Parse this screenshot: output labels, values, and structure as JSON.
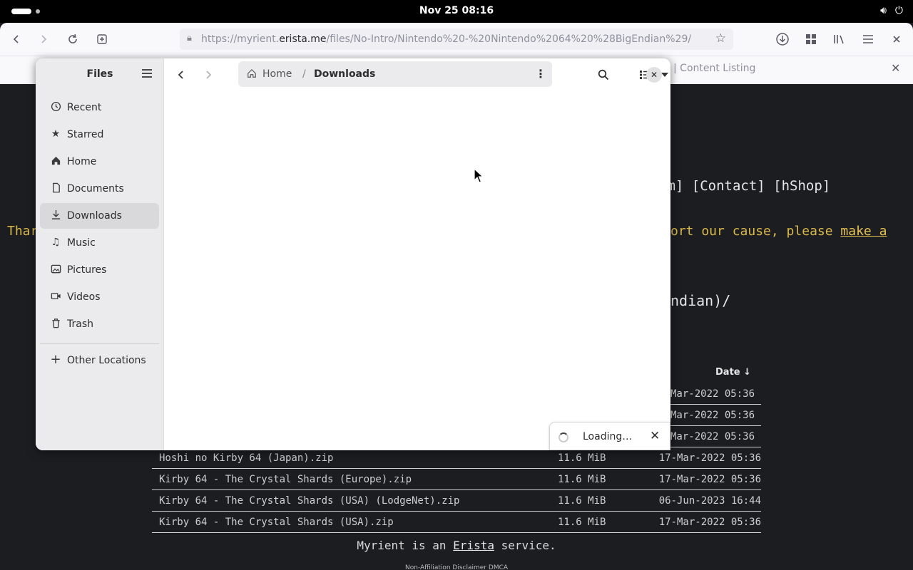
{
  "system": {
    "clock": "Nov 25  08:16",
    "tray": [
      "volume-icon",
      "power-icon"
    ]
  },
  "browser": {
    "url_prefix": "https://myrient.",
    "url_domain": "erista.me",
    "url_path": "/files/No-Intro/Nintendo%20-%20Nintendo%2064%20%28BigEndian%29/",
    "tab_title": "| Content Listing"
  },
  "webpage": {
    "nav_links": "am] [Contact] [hShop]",
    "notice_left": "Thar",
    "notice_right": "ort our cause, please ",
    "notice_link": "make a",
    "path_tail": "ndian)/",
    "date_header": "Date  ↓",
    "hidden_rows_dates": [
      "Mar-2022 05:36",
      "Mar-2022 05:36",
      "Mar-2022 05:36"
    ],
    "files": [
      {
        "name": "Hoshi no Kirby 64 (Japan).zip",
        "size": "11.6 MiB",
        "date": "17-Mar-2022 05:36"
      },
      {
        "name": "Kirby 64 - The Crystal Shards (Europe).zip",
        "size": "11.6 MiB",
        "date": "17-Mar-2022 05:36"
      },
      {
        "name": "Kirby 64 - The Crystal Shards (USA) (LodgeNet).zip",
        "size": "11.6 MiB",
        "date": "06-Jun-2023 16:44"
      },
      {
        "name": "Kirby 64 - The Crystal Shards (USA).zip",
        "size": "11.6 MiB",
        "date": "17-Mar-2022 05:36"
      }
    ],
    "footer_pre": "Myrient is an ",
    "footer_link": "Erista",
    "footer_post": " service.",
    "footer_small": "Non-Affiliation Disclaimer DMCA"
  },
  "files_app": {
    "title": "Files",
    "sidebar": [
      {
        "label": "Recent",
        "icon": "clock-icon"
      },
      {
        "label": "Starred",
        "icon": "star-icon"
      },
      {
        "label": "Home",
        "icon": "home-icon"
      },
      {
        "label": "Documents",
        "icon": "document-icon"
      },
      {
        "label": "Downloads",
        "icon": "download-icon"
      },
      {
        "label": "Music",
        "icon": "music-icon"
      },
      {
        "label": "Pictures",
        "icon": "picture-icon"
      },
      {
        "label": "Videos",
        "icon": "video-icon"
      },
      {
        "label": "Trash",
        "icon": "trash-icon"
      }
    ],
    "other_locations": "Other Locations",
    "path_home": "Home",
    "path_current": "Downloads",
    "loading": "Loading…"
  }
}
